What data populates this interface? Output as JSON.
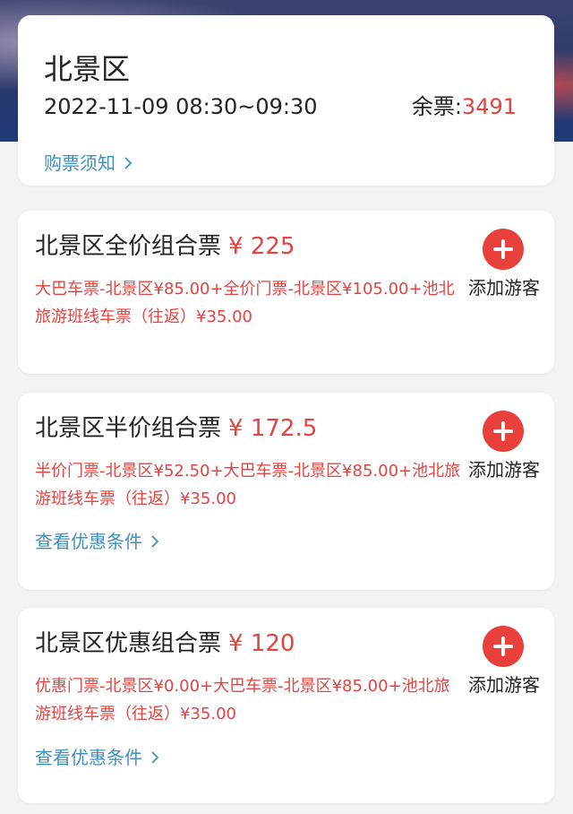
{
  "header": {
    "scenic_name": "北景区",
    "datetime": "2022-11-09 08:30~09:30",
    "remaining_label": "余票:",
    "remaining_count": "3491",
    "notice_link": "购票须知"
  },
  "tickets": [
    {
      "name": "北景区全价组合票",
      "price": "¥ 225",
      "description": "大巴车票-北景区¥85.00+全价门票-北景区¥105.00+池北旅游班线车票（往返）¥35.00",
      "add_label": "添加游客"
    },
    {
      "name": "北景区半价组合票",
      "price": "¥ 172.5",
      "description": "半价门票-北景区¥52.50+大巴车票-北景区¥85.00+池北旅游班线车票（往返）¥35.00",
      "add_label": "添加游客",
      "condition_link": "查看优惠条件"
    },
    {
      "name": "北景区优惠组合票",
      "price": "¥ 120",
      "description": "优惠门票-北景区¥0.00+大巴车票-北景区¥85.00+池北旅游班线车票（往返）¥35.00",
      "add_label": "添加游客",
      "condition_link": "查看优惠条件"
    }
  ],
  "colors": {
    "accent_red": "#e2443f",
    "link_blue": "#3f90bf",
    "add_button": "#e8403a"
  },
  "icons": {
    "add": "plus-icon",
    "chevron": "chevron-right-icon"
  }
}
